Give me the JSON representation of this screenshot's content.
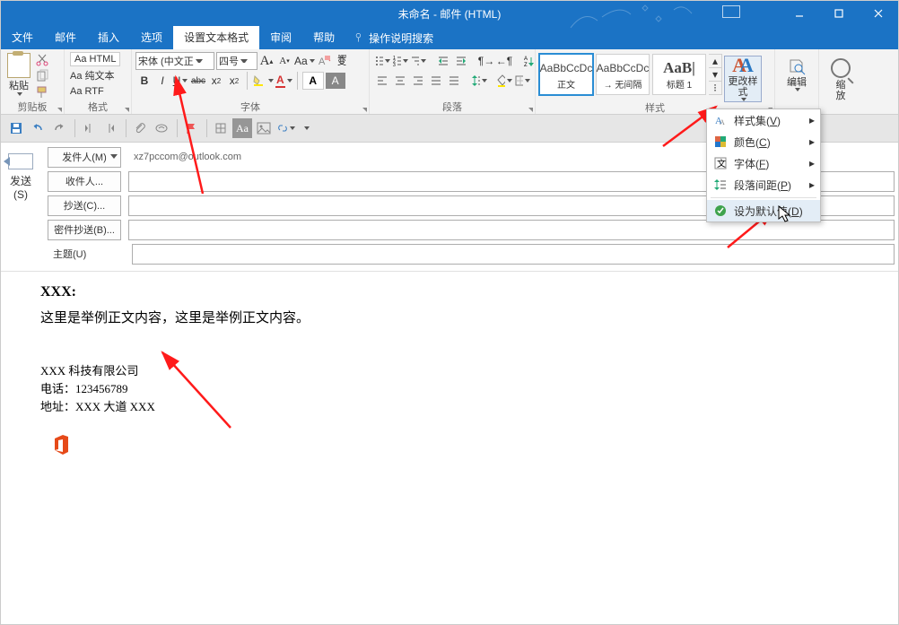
{
  "window": {
    "title": "未命名 - 邮件 (HTML)"
  },
  "menu": {
    "file": "文件",
    "mail": "邮件",
    "insert": "插入",
    "options": "选项",
    "format": "设置文本格式",
    "review": "审阅",
    "help": "帮助",
    "tell": "操作说明搜索"
  },
  "ribbon": {
    "clipboard": {
      "paste": "粘贴",
      "label": "剪贴板"
    },
    "format_grp": {
      "html": "Aa HTML",
      "plain": "Aa 纯文本",
      "rtf": "Aa RTF",
      "label": "格式"
    },
    "font_grp": {
      "font_name": "宋体 (中文正",
      "font_size": "四号",
      "label": "字体"
    },
    "para_grp": {
      "label": "段落"
    },
    "styles_grp": {
      "s1_sample": "AaBbCcDc",
      "s1_name": "正文",
      "s2_sample": "AaBbCcDc",
      "s2_name": "→ 无间隔",
      "s3_sample": "AaB|",
      "s3_name": "标题 1",
      "change": "更改样式",
      "label": "样式"
    },
    "edit_grp": {
      "label": "编辑"
    },
    "zoom_grp": {
      "l1": "缩",
      "l2": "放"
    }
  },
  "dropdown": {
    "style_set": "样式集",
    "v": "V",
    "color": "颜色",
    "c": "C",
    "font": "字体",
    "f": "F",
    "para_space": "段落间距",
    "p": "P",
    "set_default": "设为默认值",
    "d": "D"
  },
  "compose": {
    "send": "发送",
    "send_key": "(S)",
    "sender_btn": "发件人(M)",
    "sender_val": "xz7pccom@outlook.com",
    "to_btn": "收件人...",
    "cc_btn": "抄送(C)...",
    "bcc_btn": "密件抄送(B)...",
    "subject": "主题(U)"
  },
  "body": {
    "greeting": "XXX:",
    "para": "这里是举例正文内容，这里是举例正文内容。",
    "sig_company": "XXX 科技有限公司",
    "sig_phone": "电话：123456789",
    "sig_addr": "地址：XXX 大道 XXX"
  }
}
